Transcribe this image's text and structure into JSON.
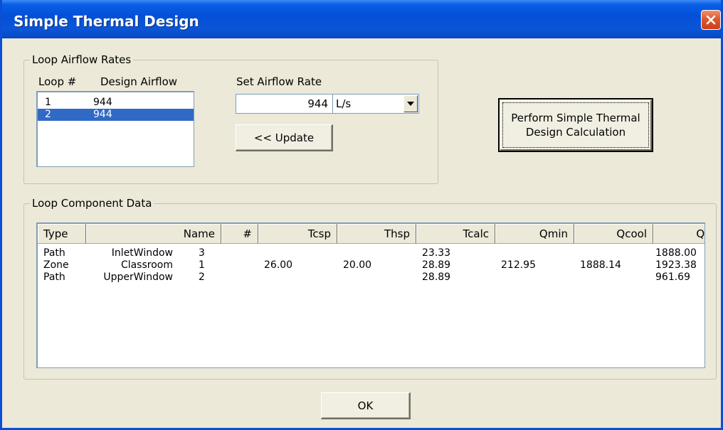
{
  "window": {
    "title": "Simple Thermal Design"
  },
  "loop_airflow": {
    "group_label": "Loop Airflow Rates",
    "col_loop_header": "Loop #",
    "col_airflow_header": "Design Airflow",
    "rows": [
      {
        "loop": "1",
        "airflow": "944",
        "selected": false
      },
      {
        "loop": "2",
        "airflow": "944",
        "selected": true
      }
    ],
    "set_rate_label": "Set Airflow Rate",
    "rate_value": "944",
    "unit_selected": "L/s",
    "update_label": "<< Update"
  },
  "perform_button": {
    "label_line1": "Perform Simple Thermal",
    "label_line2": "Design Calculation"
  },
  "component_data": {
    "group_label": "Loop Component Data",
    "columns": [
      "Type",
      "Name",
      "#",
      "Tcsp",
      "Thsp",
      "Tcalc",
      "Qmin",
      "Qcool",
      "Qcalc"
    ],
    "rows": [
      [
        "Path",
        "InletWindow",
        "3",
        "",
        "",
        "23.33",
        "",
        "",
        "1888.00"
      ],
      [
        "Zone",
        "Classroom",
        "1",
        "26.00",
        "20.00",
        "28.89",
        "212.95",
        "1888.14",
        "1923.38"
      ],
      [
        "Path",
        "UpperWindow",
        "2",
        "",
        "",
        "28.89",
        "",
        "",
        "961.69"
      ]
    ]
  },
  "ok_label": "OK",
  "icons": {
    "close": "close-x-icon",
    "dropdown": "chevron-down-icon"
  },
  "colors": {
    "titlebar": "#0a56d8",
    "selection": "#316ac5",
    "dialog_bg": "#ece9d8",
    "close_button": "#e0572c"
  }
}
